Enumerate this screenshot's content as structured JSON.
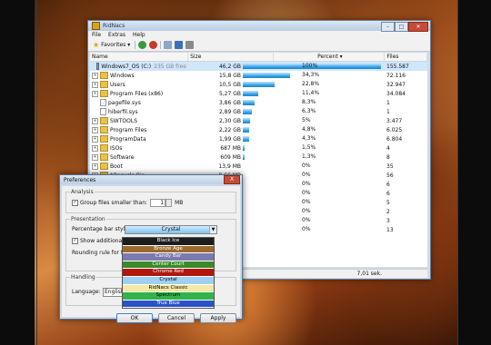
{
  "main_window": {
    "title": "RidNacs",
    "menu": [
      "File",
      "Extras",
      "Help"
    ],
    "toolbar": {
      "favorites_label": "Favorites"
    },
    "columns": {
      "name": "Name",
      "size": "Size",
      "percent": "Percent",
      "files": "Files"
    },
    "rows": [
      {
        "name": "Windows7_OS (C:)",
        "note": "235 GB free",
        "size": "46,2 GB",
        "percent": "100%",
        "pct": 100,
        "files": "155.587",
        "icon": "drive"
      },
      {
        "name": "Windows",
        "size": "15,8 GB",
        "percent": "34,3%",
        "pct": 34.3,
        "files": "72.116",
        "icon": "folder"
      },
      {
        "name": "Users",
        "size": "10,5 GB",
        "percent": "22,8%",
        "pct": 22.8,
        "files": "32.947",
        "icon": "folder"
      },
      {
        "name": "Program Files (x86)",
        "size": "5,27 GB",
        "percent": "11,4%",
        "pct": 11.4,
        "files": "34.084",
        "icon": "folder"
      },
      {
        "name": "pagefile.sys",
        "size": "3,86 GB",
        "percent": "8,3%",
        "pct": 8.3,
        "files": "1",
        "icon": "file"
      },
      {
        "name": "hiberfil.sys",
        "size": "2,89 GB",
        "percent": "6,3%",
        "pct": 6.3,
        "files": "1",
        "icon": "file"
      },
      {
        "name": "SWTOOLS",
        "size": "2,30 GB",
        "percent": "5%",
        "pct": 5,
        "files": "3.477",
        "icon": "folder"
      },
      {
        "name": "Program Files",
        "size": "2,22 GB",
        "percent": "4,8%",
        "pct": 4.8,
        "files": "6.025",
        "icon": "folder"
      },
      {
        "name": "ProgramData",
        "size": "1,99 GB",
        "percent": "4,3%",
        "pct": 4.3,
        "files": "6.804",
        "icon": "folder"
      },
      {
        "name": "ISOs",
        "size": "687 MB",
        "percent": "1,5%",
        "pct": 1.5,
        "files": "4",
        "icon": "folder"
      },
      {
        "name": "Software",
        "size": "609 MB",
        "percent": "1,3%",
        "pct": 1.3,
        "files": "8",
        "icon": "folder"
      },
      {
        "name": "Boot",
        "size": "13,9 MB",
        "percent": "0%",
        "pct": 0,
        "files": "35",
        "icon": "folder"
      },
      {
        "name": "$Recycle.Bin",
        "size": "9,66 MB",
        "percent": "0%",
        "pct": 0,
        "files": "56",
        "icon": "folder"
      },
      {
        "name": "",
        "size": "",
        "percent": "0%",
        "pct": 0,
        "files": "6",
        "icon": "folder"
      },
      {
        "name": "",
        "size": "",
        "percent": "0%",
        "pct": 0,
        "files": "6",
        "icon": "folder"
      },
      {
        "name": "",
        "size": "",
        "percent": "0%",
        "pct": 0,
        "files": "5",
        "icon": "folder"
      },
      {
        "name": "",
        "size": "",
        "percent": "0%",
        "pct": 0,
        "files": "2",
        "icon": "folder"
      },
      {
        "name": "",
        "size": "",
        "percent": "0%",
        "pct": 0,
        "files": "3",
        "icon": "folder"
      },
      {
        "name": "",
        "size": "",
        "percent": "0%",
        "pct": 0,
        "files": "13",
        "icon": "folder"
      }
    ],
    "status": "7,01 sek."
  },
  "prefs": {
    "title": "Preferences",
    "close": "X",
    "analysis": {
      "legend": "Analysis",
      "group_label": "Group files smaller than:",
      "group_value": "1",
      "group_unit": "MB",
      "group_checked": true
    },
    "presentation": {
      "legend": "Presentation",
      "bar_style_label": "Percentage bar style:",
      "bar_style_value": "Crystal",
      "show_additional_label": "Show additional pe",
      "show_additional_checked": true,
      "rounding_label": "Rounding rule for file si"
    },
    "handling": {
      "legend": "Handling",
      "language_label": "Language:",
      "language_value": "English (e"
    },
    "buttons": {
      "ok": "OK",
      "cancel": "Cancel",
      "apply": "Apply"
    }
  },
  "bar_styles": [
    {
      "label": "Black Ice",
      "bg": "#1d1d1d",
      "fg": "#ffffff"
    },
    {
      "label": "Bronze Age",
      "bg": "#9b6a2c",
      "fg": "#ffffff"
    },
    {
      "label": "Candy Bar",
      "bg": "#7a7ab0",
      "fg": "#ffffff"
    },
    {
      "label": "Center Court",
      "bg": "#3a8a2a",
      "fg": "#ffffff"
    },
    {
      "label": "Chrome Red",
      "bg": "#b0180f",
      "fg": "#ffffff"
    },
    {
      "label": "Crystal",
      "bg": "#9fd0f2",
      "fg": "#000000"
    },
    {
      "label": "RidNacs Classic",
      "bg": "#f4e9a0",
      "fg": "#000000"
    },
    {
      "label": "Spectrum",
      "bg": "#2fb34a",
      "fg": "#000000"
    },
    {
      "label": "True Blue",
      "bg": "#2a52c8",
      "fg": "#ffffff"
    }
  ]
}
